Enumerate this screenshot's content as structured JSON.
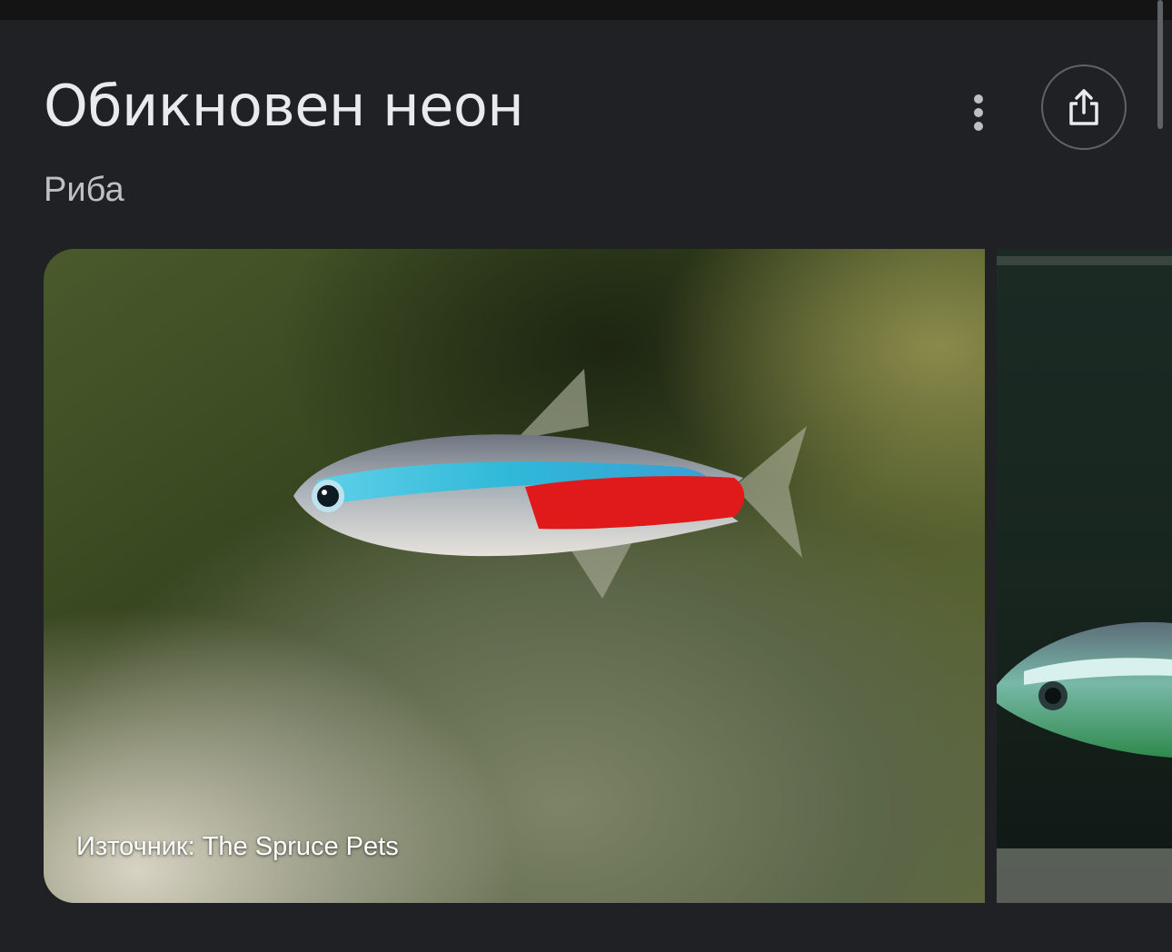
{
  "header": {
    "title": "Обикновен неон",
    "subtitle": "Риба"
  },
  "actions": {
    "more_icon": "more-vert-icon",
    "share_icon": "share-icon"
  },
  "carousel": {
    "images": [
      {
        "caption": "Източник: The Spruce Pets",
        "subject": "neon tetra"
      },
      {
        "subject": "neon tetra"
      }
    ]
  },
  "colors": {
    "background": "#202124",
    "text_primary": "#e8eaed",
    "text_secondary": "#bdc1c6",
    "outline": "#5f6368"
  }
}
